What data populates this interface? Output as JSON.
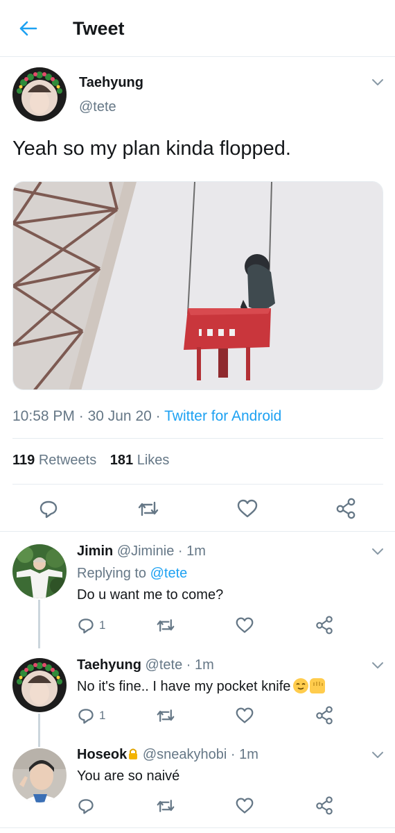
{
  "header": {
    "title": "Tweet"
  },
  "tweet": {
    "author_name": "Taehyung",
    "author_handle": "@tete",
    "text": "Yeah so my plan kinda flopped.",
    "time": "10:58 PM",
    "date": "30 Jun 20",
    "source": "Twitter for Android",
    "retweets_count": "119",
    "retweets_label": "Retweets",
    "likes_count": "181",
    "likes_label": "Likes"
  },
  "replies": [
    {
      "name": "Jimin",
      "handle": "@Jiminie",
      "time": "1m",
      "replying_prefix": "Replying to",
      "replying_to": "@tete",
      "text": "Do u want me to come?",
      "reply_count": "1"
    },
    {
      "name": "Taehyung",
      "handle": "@tete",
      "time": "1m",
      "text": "No it's fine.. I have my pocket knife",
      "reply_count": "1"
    },
    {
      "name": "Hoseok",
      "handle": "@sneakyhobi",
      "time": "1m",
      "text": "You are so naivé",
      "reply_count": ""
    }
  ],
  "colors": {
    "accent": "#1da1f2",
    "muted": "#657786",
    "text": "#14171a",
    "divider": "#e6ecf0"
  },
  "icons": [
    "back-arrow-icon",
    "chevron-down-icon",
    "reply-icon",
    "retweet-icon",
    "like-icon",
    "share-icon",
    "lock-icon"
  ]
}
